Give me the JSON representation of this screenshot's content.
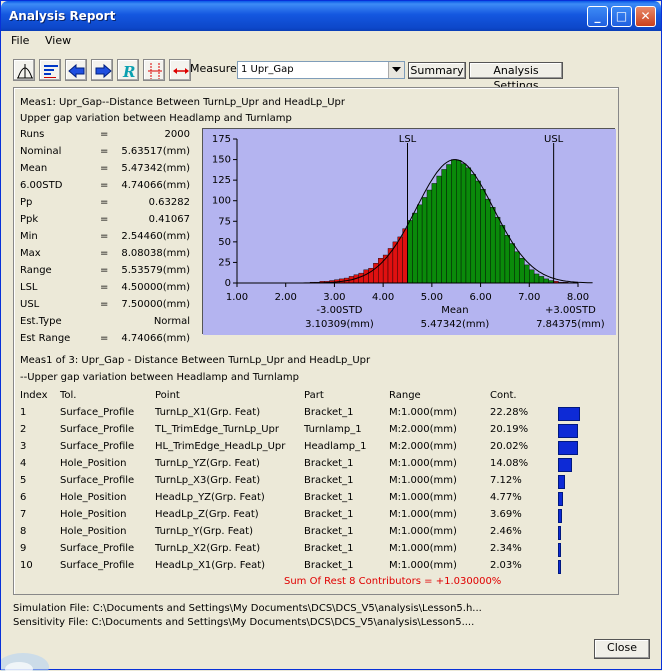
{
  "window": {
    "title": "Analysis Report"
  },
  "menu": [
    "File",
    "View"
  ],
  "toolbar": {
    "icons": [
      "histogram-icon",
      "sort-list-icon",
      "previous-icon",
      "next-icon",
      "r-icon",
      "spec-limits-icon",
      "range-arrows-icon"
    ],
    "measure_label": "Measure:",
    "measure_value": "1 Upr_Gap",
    "summary_label": "Summary",
    "settings_label": "Analysis Settings"
  },
  "header": {
    "line1": "Meas1: Upr_Gap--Distance Between TurnLp_Upr and HeadLp_Upr",
    "line2": "Upper gap variation between Headlamp and Turnlamp"
  },
  "stats": [
    {
      "name": "Runs",
      "eq": "=",
      "value": "2000"
    },
    {
      "name": "Nominal",
      "eq": "=",
      "value": "5.63517(mm)"
    },
    {
      "name": "Mean",
      "eq": "=",
      "value": "5.47342(mm)"
    },
    {
      "name": "6.00STD",
      "eq": "=",
      "value": "4.74066(mm)"
    },
    {
      "name": "Pp",
      "eq": "=",
      "value": "0.63282"
    },
    {
      "name": "Ppk",
      "eq": "=",
      "value": "0.41067"
    },
    {
      "name": "Min",
      "eq": "=",
      "value": "2.54460(mm)"
    },
    {
      "name": "Max",
      "eq": "=",
      "value": "8.08038(mm)"
    },
    {
      "name": "Range",
      "eq": "=",
      "value": "5.53579(mm)"
    },
    {
      "name": "LSL",
      "eq": "=",
      "value": "4.50000(mm)"
    },
    {
      "name": "USL",
      "eq": "=",
      "value": "7.50000(mm)"
    },
    {
      "name": "Est.Type",
      "eq": "",
      "value": "Normal"
    },
    {
      "name": "Est Range",
      "eq": "=",
      "value": "4.74066(mm)"
    }
  ],
  "chart_data": {
    "type": "bar",
    "title": "",
    "xlim": [
      1.0,
      8.0
    ],
    "ylim": [
      0,
      175
    ],
    "x_ticks": [
      "1.00",
      "2.00",
      "3.00",
      "4.00",
      "5.00",
      "6.00",
      "7.00",
      "8.00"
    ],
    "y_ticks": [
      "0",
      "25",
      "50",
      "75",
      "100",
      "125",
      "150",
      "175"
    ],
    "bins": [
      {
        "x": 2.55,
        "y": 1
      },
      {
        "x": 2.65,
        "y": 1
      },
      {
        "x": 2.75,
        "y": 2
      },
      {
        "x": 2.85,
        "y": 2
      },
      {
        "x": 2.95,
        "y": 3
      },
      {
        "x": 3.05,
        "y": 4
      },
      {
        "x": 3.15,
        "y": 5
      },
      {
        "x": 3.25,
        "y": 6
      },
      {
        "x": 3.35,
        "y": 8
      },
      {
        "x": 3.45,
        "y": 10
      },
      {
        "x": 3.55,
        "y": 12
      },
      {
        "x": 3.65,
        "y": 16
      },
      {
        "x": 3.75,
        "y": 18
      },
      {
        "x": 3.85,
        "y": 24
      },
      {
        "x": 3.95,
        "y": 30
      },
      {
        "x": 4.05,
        "y": 34
      },
      {
        "x": 4.15,
        "y": 42
      },
      {
        "x": 4.25,
        "y": 50
      },
      {
        "x": 4.35,
        "y": 56
      },
      {
        "x": 4.45,
        "y": 66
      },
      {
        "x": 4.55,
        "y": 76
      },
      {
        "x": 4.65,
        "y": 85
      },
      {
        "x": 4.75,
        "y": 95
      },
      {
        "x": 4.85,
        "y": 104
      },
      {
        "x": 4.95,
        "y": 113
      },
      {
        "x": 5.05,
        "y": 121
      },
      {
        "x": 5.15,
        "y": 130
      },
      {
        "x": 5.25,
        "y": 138
      },
      {
        "x": 5.35,
        "y": 144
      },
      {
        "x": 5.45,
        "y": 150
      },
      {
        "x": 5.55,
        "y": 149
      },
      {
        "x": 5.65,
        "y": 145
      },
      {
        "x": 5.75,
        "y": 140
      },
      {
        "x": 5.85,
        "y": 132
      },
      {
        "x": 5.95,
        "y": 124
      },
      {
        "x": 6.05,
        "y": 114
      },
      {
        "x": 6.15,
        "y": 102
      },
      {
        "x": 6.25,
        "y": 92
      },
      {
        "x": 6.35,
        "y": 80
      },
      {
        "x": 6.45,
        "y": 70
      },
      {
        "x": 6.55,
        "y": 58
      },
      {
        "x": 6.65,
        "y": 48
      },
      {
        "x": 6.75,
        "y": 38
      },
      {
        "x": 6.85,
        "y": 30
      },
      {
        "x": 6.95,
        "y": 22
      },
      {
        "x": 7.05,
        "y": 16
      },
      {
        "x": 7.15,
        "y": 11
      },
      {
        "x": 7.25,
        "y": 8
      },
      {
        "x": 7.35,
        "y": 5
      },
      {
        "x": 7.45,
        "y": 3
      },
      {
        "x": 7.55,
        "y": 2
      },
      {
        "x": 7.65,
        "y": 1
      },
      {
        "x": 7.75,
        "y": 1
      },
      {
        "x": 7.95,
        "y": 1
      }
    ],
    "bin_width": 0.1,
    "normal_curve": {
      "mean": 5.47342,
      "std": 0.79011,
      "peak": 150
    },
    "limits": [
      {
        "label": "LSL",
        "x": 4.5
      },
      {
        "label": "USL",
        "x": 7.5
      }
    ],
    "markers": [
      {
        "label": "-3.00STD",
        "value": "3.10309(mm)",
        "x": 3.10309
      },
      {
        "label": "Mean",
        "value": "5.47342(mm)",
        "x": 5.47342
      },
      {
        "label": "+3.00STD",
        "value": "7.84375(mm)",
        "x": 7.84375
      }
    ],
    "colors": {
      "plot_bg": "#b4b4f0",
      "in_spec": "#0a8a0a",
      "out_spec": "#e01010",
      "curve": "#000000",
      "limit_line": "#000000"
    }
  },
  "contributors": {
    "title": "Meas1 of 3: Upr_Gap - Distance Between TurnLp_Upr and HeadLp_Upr",
    "subtitle": "--Upper gap variation between Headlamp and Turnlamp",
    "columns": [
      "Index",
      "Tol.",
      "Point",
      "Part",
      "Range",
      "Cont."
    ],
    "rows": [
      {
        "index": "1",
        "tol": "Surface_Profile",
        "point": "TurnLp_X1(Grp. Feat)",
        "part": "Bracket_1",
        "range": "M:1.000(mm)",
        "cont": "22.28%",
        "pct": 22.28
      },
      {
        "index": "2",
        "tol": "Surface_Profile",
        "point": "TL_TrimEdge_TurnLp_Upr",
        "part": "Turnlamp_1",
        "range": "M:2.000(mm)",
        "cont": "20.19%",
        "pct": 20.19
      },
      {
        "index": "3",
        "tol": "Surface_Profile",
        "point": "HL_TrimEdge_HeadLp_Upr",
        "part": "Headlamp_1",
        "range": "M:2.000(mm)",
        "cont": "20.02%",
        "pct": 20.02
      },
      {
        "index": "4",
        "tol": "Hole_Position",
        "point": "TurnLp_YZ(Grp. Feat)",
        "part": "Bracket_1",
        "range": "M:1.000(mm)",
        "cont": "14.08%",
        "pct": 14.08
      },
      {
        "index": "5",
        "tol": "Surface_Profile",
        "point": "TurnLp_X3(Grp. Feat)",
        "part": "Bracket_1",
        "range": "M:1.000(mm)",
        "cont": "7.12%",
        "pct": 7.12
      },
      {
        "index": "6",
        "tol": "Hole_Position",
        "point": "HeadLp_YZ(Grp. Feat)",
        "part": "Bracket_1",
        "range": "M:1.000(mm)",
        "cont": "4.77%",
        "pct": 4.77
      },
      {
        "index": "7",
        "tol": "Hole_Position",
        "point": "HeadLp_Z(Grp. Feat)",
        "part": "Bracket_1",
        "range": "M:1.000(mm)",
        "cont": "3.69%",
        "pct": 3.69
      },
      {
        "index": "8",
        "tol": "Hole_Position",
        "point": "TurnLp_Y(Grp. Feat)",
        "part": "Bracket_1",
        "range": "M:1.000(mm)",
        "cont": "2.46%",
        "pct": 2.46
      },
      {
        "index": "9",
        "tol": "Surface_Profile",
        "point": "TurnLp_X2(Grp. Feat)",
        "part": "Bracket_1",
        "range": "M:1.000(mm)",
        "cont": "2.34%",
        "pct": 2.34
      },
      {
        "index": "10",
        "tol": "Surface_Profile",
        "point": "HeadLp_X1(Grp. Feat)",
        "part": "Bracket_1",
        "range": "M:1.000(mm)",
        "cont": "2.03%",
        "pct": 2.03
      }
    ],
    "sum_rest": "Sum Of Rest 8 Contributors = +1.030000%",
    "bar_color": "#0d2ad6",
    "sum_color": "#e00000"
  },
  "footer": {
    "simulation": "Simulation File: C:\\Documents and Settings\\My Documents\\DCS\\DCS_V5\\analysis\\Lesson5.h...",
    "sensitivity": "Sensitivity File: C:\\Documents and Settings\\My Documents\\DCS\\DCS_V5\\analysis\\Lesson5....",
    "close_label": "Close"
  }
}
